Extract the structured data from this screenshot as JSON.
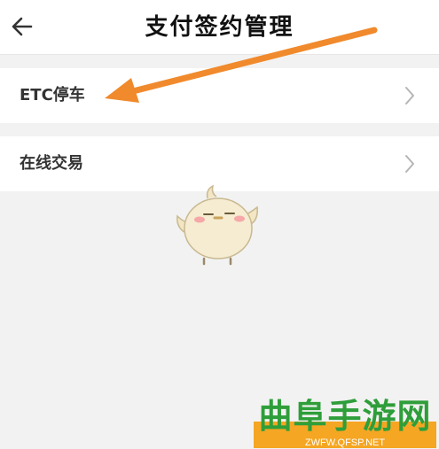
{
  "header": {
    "title": "支付签约管理",
    "back_icon": "arrow-left-icon"
  },
  "list": {
    "items": [
      {
        "label": "ETC停车",
        "icon": "chevron-right-icon"
      },
      {
        "label": "在线交易",
        "icon": "chevron-right-icon"
      }
    ]
  },
  "overlay": {
    "annotation_color": "#f08a2c",
    "mascot": "chick-mascot"
  },
  "watermark": {
    "title": "曲阜手游网",
    "url": "ZWFW.QFSP.NET",
    "band_color": "#f5a623",
    "title_color": "#2e9e3a"
  }
}
